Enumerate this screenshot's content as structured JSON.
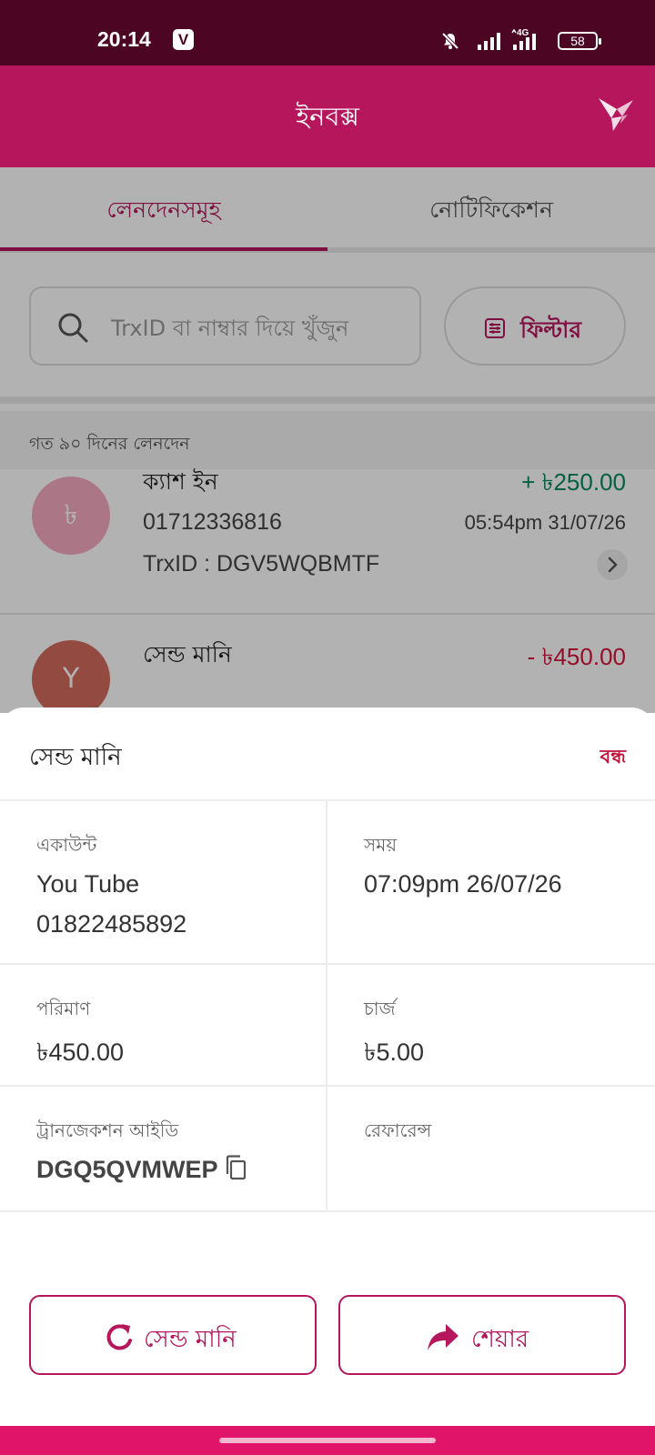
{
  "status_bar": {
    "time": "20:14",
    "app_badge": "V",
    "network": "4G",
    "battery": "58",
    "icons": [
      "mute-icon",
      "signal-icon",
      "signal-4g-icon",
      "battery-icon"
    ]
  },
  "app_bar": {
    "title": "ইনবক্স",
    "logo": "bird-logo-icon",
    "background": "#b5165c"
  },
  "tabs": [
    {
      "label": "লেনদেনসমূহ",
      "active": true
    },
    {
      "label": "নোটিফিকেশন",
      "active": false
    }
  ],
  "search": {
    "placeholder": "TrxID বা নাম্বার দিয়ে খুঁজুন",
    "filter_label": "ফিল্টার"
  },
  "section_heading": "গত ৯০ দিনের লেনদেন",
  "transactions": [
    {
      "avatar": "৳",
      "title": "ক্যাশ ইন",
      "number": "01712336816",
      "trx": "TrxID : DGV5WQBMTF",
      "amount": "+ ৳250.00",
      "time": "05:54pm 31/07/26"
    },
    {
      "avatar": "Y",
      "title": "সেন্ড মানি",
      "amount": "- ৳450.00"
    }
  ],
  "sheet": {
    "title": "সেন্ড মানি",
    "close_label": "বন্ধ",
    "account_label": "একাউন্ট",
    "account_name": "You Tube",
    "account_number": "01822485892",
    "time_label": "সময়",
    "time_value": "07:09pm 26/07/26",
    "amount_label": "পরিমাণ",
    "amount_value": "৳450.00",
    "charge_label": "চার্জ",
    "charge_value": "৳5.00",
    "trxid_label": "ট্রানজেকশন আইডি",
    "trxid_value": "DGQ5QVMWEP",
    "reference_label": "রেফারেন্স",
    "reference_value": "",
    "send_money_button": "সেন্ড মানি",
    "share_button": "শেয়ার"
  },
  "colors": {
    "accent": "#b5165c",
    "status_bar": "#4d0524",
    "credit": "#0a8a5c",
    "debit": "#d4153a",
    "nav_bar": "#e0156a"
  }
}
